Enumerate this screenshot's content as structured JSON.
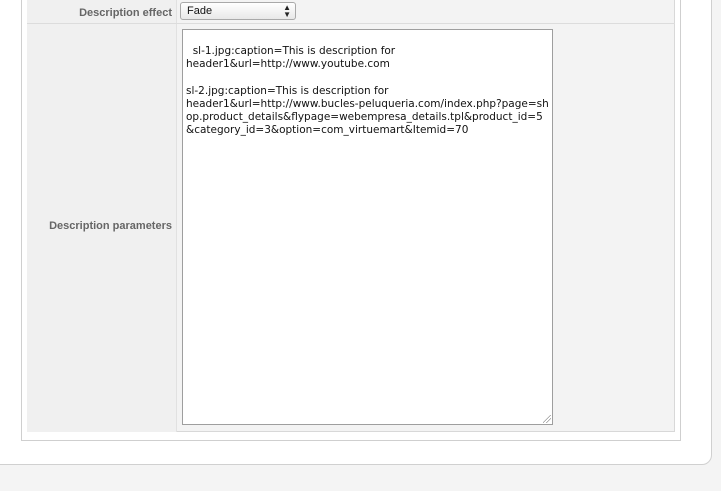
{
  "params": {
    "description_effect": {
      "label": "Description effect",
      "selected": "Fade"
    },
    "description_parameters": {
      "label": "Description parameters",
      "value": "sl-1.jpg:caption=This is description for\nheader1&url=http://www.youtube.com\n\nsl-2.jpg:caption=This is description for\nheader1&url=http://www.bucles-peluqueria.com/index.php?page=shop.product_details&flypage=webempresa_details.tpl&product_id=5&category_id=3&option=com_virtuemart&Itemid=70"
    }
  },
  "footer": {
    "prefix": "",
    "link": ""
  },
  "icons": {
    "select_arrow": "up-down-arrow-icon",
    "resize": "resize-grip-icon"
  }
}
